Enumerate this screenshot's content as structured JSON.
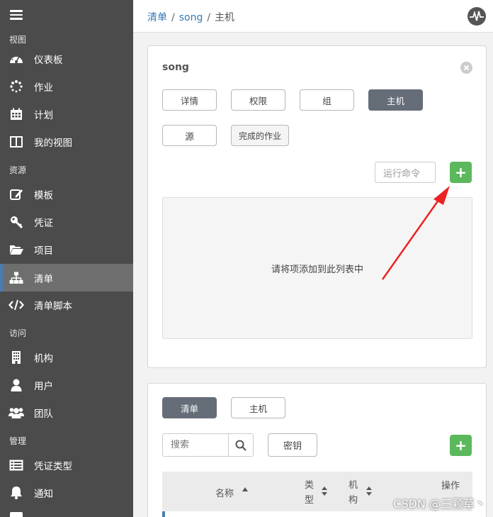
{
  "sidebar": {
    "sections": {
      "views": "视图",
      "resources": "资源",
      "access": "访问",
      "admin": "管理"
    },
    "items": [
      {
        "label": "仪表板",
        "icon": "dashboard-icon"
      },
      {
        "label": "作业",
        "icon": "spinner-icon"
      },
      {
        "label": "计划",
        "icon": "calendar-icon"
      },
      {
        "label": "我的视图",
        "icon": "columns-icon"
      },
      {
        "label": "模板",
        "icon": "edit-icon"
      },
      {
        "label": "凭证",
        "icon": "key-icon"
      },
      {
        "label": "项目",
        "icon": "folder-icon"
      },
      {
        "label": "清单",
        "icon": "sitemap-icon",
        "active": true
      },
      {
        "label": "清单脚本",
        "icon": "code-icon"
      },
      {
        "label": "机构",
        "icon": "building-icon"
      },
      {
        "label": "用户",
        "icon": "user-icon"
      },
      {
        "label": "团队",
        "icon": "users-icon"
      },
      {
        "label": "凭证类型",
        "icon": "list-icon"
      },
      {
        "label": "通知",
        "icon": "bell-icon"
      }
    ]
  },
  "breadcrumb": {
    "items": [
      "清单",
      "song",
      "主机"
    ],
    "separator": "/"
  },
  "top_panel": {
    "title": "song",
    "tabs": [
      "详情",
      "权限",
      "组",
      "主机",
      "源",
      "完成的作业"
    ],
    "active_tab": "主机",
    "run_command_label": "运行命令",
    "add_label": "+",
    "empty_message": "请将项添加到此列表中"
  },
  "bottom_panel": {
    "tabs": [
      "清单",
      "主机"
    ],
    "active_tab": "清单",
    "search_placeholder": "搜索",
    "key_button": "密钥",
    "add_label": "+",
    "columns": [
      "名称",
      "类型",
      "机构",
      "操作"
    ]
  },
  "watermark": "CSDN @三颗草丶",
  "colors": {
    "sidebar_bg": "#4b4b4b",
    "sidebar_active": "#6e6e6e",
    "accent_blue": "#4a7eb2",
    "link_blue": "#337ab7",
    "active_tab": "#656d78",
    "green": "#5cb85c",
    "arrow_red": "#ee2222"
  }
}
